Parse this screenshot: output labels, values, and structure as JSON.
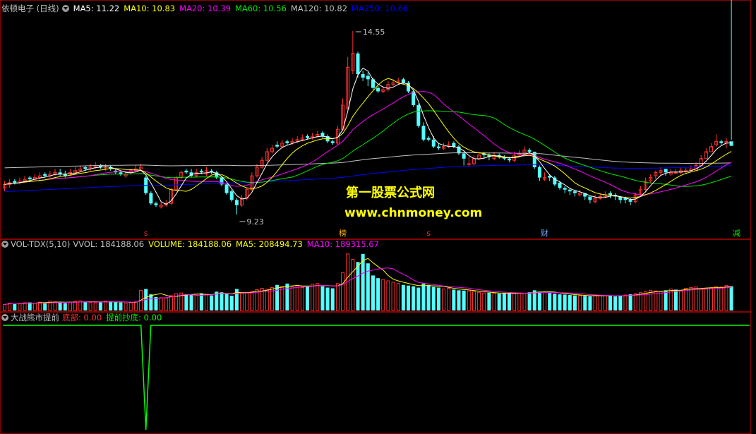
{
  "colors": {
    "up": "#ff3232",
    "down": "#54ffff",
    "bg": "#000000",
    "border": "#8b0000",
    "ma5": "#ffffff",
    "ma10": "#ffff00",
    "ma20": "#ff00ff",
    "ma60": "#00e600",
    "ma120": "#c0c0c0",
    "ma250": "#0000ff",
    "signal": "#00ff00",
    "watermark": "#ffff00"
  },
  "main_legend": {
    "title": "依顿电子 (日线)",
    "ma5": "MA5: 11.22",
    "ma10": "MA10: 10.83",
    "ma20": "MA20: 10.39",
    "ma60": "MA60: 10.56",
    "ma120": "MA120: 10.82",
    "ma250": "MA250: 10.66"
  },
  "annotations": {
    "high": "14.55",
    "low": "9.23"
  },
  "markers": [
    {
      "label": "s",
      "color": "#ff3232",
      "index": 28
    },
    {
      "label": "榜",
      "color": "#ffb400",
      "index": 67
    },
    {
      "label": "s",
      "color": "#ff3232",
      "index": 84
    },
    {
      "label": "财",
      "color": "#6fa8ff",
      "index": 107
    },
    {
      "label": "减",
      "color": "#00e600",
      "index": 145
    }
  ],
  "watermark": {
    "line1": "第一股票公式网",
    "line2": "www.chnmoney.com"
  },
  "vol_legend": {
    "name": "VOL-TDX(5,10)",
    "vvol": "VVOL: 184188.06",
    "volume": "VOLUME: 184188.06",
    "ma5": "MA5: 208494.73",
    "ma10": "MA10: 189315.67"
  },
  "ind_legend": {
    "name": "大战熊市提前",
    "bottom": "底部: 0.00",
    "early": "提前抄底: 0.00"
  },
  "chart_data": [
    {
      "type": "candlestick",
      "title": "依顿电子 (日线)",
      "ylim": [
        8.9,
        15.0
      ],
      "close": [
        10.1,
        10.15,
        10.15,
        10.2,
        10.25,
        10.25,
        10.3,
        10.35,
        10.35,
        10.4,
        10.45,
        10.4,
        10.35,
        10.45,
        10.5,
        10.55,
        10.55,
        10.6,
        10.65,
        10.6,
        10.6,
        10.55,
        10.45,
        10.4,
        10.4,
        10.5,
        10.55,
        10.6,
        9.85,
        9.55,
        9.5,
        9.5,
        9.55,
        9.95,
        10.3,
        10.45,
        10.45,
        10.35,
        10.45,
        10.45,
        10.5,
        10.45,
        10.3,
        10.1,
        9.85,
        9.65,
        9.5,
        9.7,
        9.95,
        10.35,
        10.6,
        10.8,
        11.05,
        11.15,
        11.2,
        11.3,
        11.3,
        11.35,
        11.4,
        11.45,
        11.45,
        11.5,
        11.55,
        11.5,
        11.35,
        11.3,
        11.7,
        12.4,
        13.5,
        13.9,
        13.3,
        13.2,
        13.15,
        12.9,
        12.8,
        12.85,
        13.0,
        13.05,
        13.1,
        13.05,
        12.8,
        12.4,
        11.8,
        11.4,
        11.4,
        11.2,
        11.15,
        11.2,
        11.25,
        11.2,
        11.0,
        10.85,
        10.7,
        10.85,
        10.95,
        10.95,
        10.9,
        10.95,
        10.9,
        10.85,
        10.8,
        10.95,
        11.0,
        11.1,
        11.05,
        10.6,
        10.3,
        10.3,
        10.3,
        10.1,
        10.0,
        9.95,
        9.9,
        9.85,
        9.85,
        9.75,
        9.65,
        9.7,
        9.75,
        9.8,
        9.8,
        9.75,
        9.65,
        9.65,
        9.6,
        9.8,
        9.95,
        10.2,
        10.3,
        10.45,
        10.5,
        10.45,
        10.45,
        10.45,
        10.5,
        10.5,
        10.55,
        10.65,
        10.85,
        11.05,
        11.2,
        11.35,
        11.3,
        11.35,
        11.22
      ],
      "open": [
        10.0,
        10.1,
        10.2,
        10.15,
        10.2,
        10.3,
        10.25,
        10.3,
        10.4,
        10.35,
        10.4,
        10.45,
        10.4,
        10.4,
        10.45,
        10.5,
        10.6,
        10.55,
        10.6,
        10.65,
        10.55,
        10.6,
        10.5,
        10.45,
        10.35,
        10.45,
        10.5,
        10.55,
        10.3,
        9.85,
        9.55,
        9.45,
        9.5,
        9.55,
        9.95,
        10.3,
        10.5,
        10.45,
        10.35,
        10.5,
        10.4,
        10.5,
        10.45,
        10.3,
        10.1,
        9.9,
        9.65,
        9.5,
        9.7,
        9.95,
        10.35,
        10.6,
        10.8,
        11.05,
        11.25,
        11.2,
        11.35,
        11.3,
        11.35,
        11.4,
        11.5,
        11.45,
        11.5,
        11.6,
        11.5,
        11.35,
        11.3,
        11.7,
        12.3,
        13.4,
        13.9,
        13.3,
        13.25,
        13.15,
        12.9,
        12.8,
        12.85,
        13.0,
        13.05,
        13.15,
        13.05,
        12.8,
        12.4,
        11.8,
        11.45,
        11.4,
        11.2,
        11.15,
        11.2,
        11.3,
        11.2,
        11.0,
        10.7,
        10.7,
        10.85,
        11.0,
        10.95,
        10.85,
        10.95,
        10.9,
        10.85,
        10.8,
        10.95,
        11.0,
        11.1,
        11.05,
        10.6,
        10.25,
        10.35,
        10.3,
        10.15,
        10.0,
        9.95,
        9.9,
        9.8,
        9.85,
        9.75,
        9.6,
        9.7,
        9.75,
        9.85,
        9.8,
        9.75,
        9.7,
        9.65,
        9.6,
        9.8,
        9.95,
        10.2,
        10.35,
        10.45,
        10.55,
        10.4,
        10.45,
        10.45,
        10.5,
        10.5,
        10.5,
        10.65,
        10.85,
        11.05,
        11.25,
        11.35,
        11.3,
        11.35
      ],
      "high": [
        10.2,
        10.25,
        10.25,
        10.3,
        10.35,
        10.35,
        10.4,
        10.45,
        10.45,
        10.5,
        10.55,
        10.55,
        10.5,
        10.55,
        10.6,
        10.65,
        10.65,
        10.7,
        10.75,
        10.7,
        10.7,
        10.65,
        10.55,
        10.5,
        10.5,
        10.55,
        10.65,
        10.7,
        10.35,
        9.9,
        9.6,
        9.6,
        9.65,
        10.0,
        10.35,
        10.5,
        10.55,
        10.55,
        10.55,
        10.55,
        10.6,
        10.55,
        10.5,
        10.35,
        10.15,
        9.95,
        9.7,
        9.8,
        10.0,
        10.45,
        10.7,
        10.9,
        11.15,
        11.25,
        11.35,
        11.4,
        11.4,
        11.45,
        11.5,
        11.55,
        11.55,
        11.6,
        11.65,
        11.65,
        11.55,
        11.4,
        11.8,
        12.6,
        13.8,
        14.55,
        13.95,
        13.4,
        13.35,
        13.2,
        12.95,
        12.95,
        13.1,
        13.15,
        13.2,
        13.2,
        13.1,
        12.85,
        12.45,
        11.9,
        11.5,
        11.5,
        11.3,
        11.3,
        11.35,
        11.35,
        11.25,
        11.05,
        10.9,
        10.95,
        11.05,
        11.05,
        11.0,
        11.05,
        11.0,
        10.95,
        10.9,
        11.05,
        11.1,
        11.2,
        11.15,
        11.05,
        10.65,
        10.45,
        10.4,
        10.35,
        10.2,
        10.05,
        10.0,
        9.95,
        9.95,
        9.85,
        9.75,
        9.8,
        9.85,
        9.9,
        9.9,
        9.85,
        9.75,
        9.75,
        9.7,
        9.85,
        10.05,
        10.3,
        10.4,
        10.5,
        10.6,
        10.55,
        10.55,
        10.55,
        10.6,
        10.6,
        10.65,
        10.75,
        10.95,
        11.15,
        11.3,
        11.55,
        11.4,
        11.45,
        11.4
      ],
      "low": [
        9.9,
        10.0,
        10.1,
        10.1,
        10.15,
        10.2,
        10.2,
        10.25,
        10.3,
        10.3,
        10.35,
        10.35,
        10.3,
        10.35,
        10.4,
        10.45,
        10.5,
        10.5,
        10.55,
        10.55,
        10.5,
        10.5,
        10.4,
        10.35,
        10.3,
        10.4,
        10.45,
        10.5,
        9.8,
        9.5,
        9.45,
        9.4,
        9.45,
        9.5,
        9.9,
        10.25,
        10.4,
        10.3,
        10.3,
        10.4,
        10.35,
        10.4,
        10.25,
        10.05,
        9.8,
        9.6,
        9.23,
        9.45,
        9.65,
        9.9,
        10.3,
        10.55,
        10.75,
        11.0,
        11.15,
        11.15,
        11.25,
        11.25,
        11.3,
        11.35,
        11.4,
        11.4,
        11.45,
        11.45,
        11.3,
        11.25,
        11.25,
        11.65,
        12.25,
        13.3,
        13.2,
        13.1,
        12.95,
        12.85,
        12.75,
        12.75,
        12.8,
        12.95,
        13.0,
        13.0,
        12.75,
        12.35,
        11.75,
        11.35,
        11.35,
        11.15,
        11.1,
        11.1,
        11.15,
        11.15,
        10.95,
        10.65,
        10.6,
        10.65,
        10.8,
        10.85,
        10.8,
        10.8,
        10.85,
        10.8,
        10.75,
        10.75,
        10.9,
        11.0,
        11.0,
        10.55,
        10.2,
        10.2,
        10.2,
        10.05,
        9.95,
        9.85,
        9.8,
        9.75,
        9.75,
        9.65,
        9.55,
        9.55,
        9.65,
        9.7,
        9.7,
        9.65,
        9.55,
        9.55,
        9.5,
        9.55,
        9.75,
        9.9,
        10.15,
        10.25,
        10.35,
        10.35,
        10.35,
        10.4,
        10.4,
        10.4,
        10.45,
        10.55,
        10.8,
        11.0,
        11.15,
        11.2,
        11.25,
        11.15
      ],
      "ma5_last": 11.22,
      "ma10_last": 10.83,
      "ma20_last": 10.39,
      "ma60_last": 10.56,
      "ma120_last": 10.82,
      "ma250_last": 10.66,
      "annotations": [
        {
          "text": "14.55",
          "value": 14.55
        },
        {
          "text": "9.23",
          "value": 9.23
        }
      ]
    },
    {
      "type": "bar",
      "title": "VOL-TDX(5,10)",
      "series_names": [
        "VOLUME",
        "MA5",
        "MA10"
      ],
      "values": [
        45,
        55,
        50,
        52,
        58,
        60,
        55,
        62,
        58,
        70,
        65,
        60,
        55,
        62,
        68,
        72,
        66,
        60,
        58,
        65,
        70,
        68,
        62,
        60,
        55,
        58,
        65,
        150,
        160,
        120,
        100,
        95,
        92,
        110,
        125,
        130,
        118,
        115,
        120,
        128,
        118,
        112,
        140,
        135,
        125,
        110,
        160,
        130,
        135,
        142,
        155,
        165,
        158,
        170,
        190,
        180,
        200,
        175,
        185,
        170,
        180,
        195,
        200,
        180,
        170,
        165,
        200,
        280,
        420,
        380,
        360,
        420,
        350,
        260,
        240,
        230,
        220,
        210,
        200,
        190,
        185,
        180,
        170,
        200,
        190,
        175,
        170,
        160,
        165,
        155,
        150,
        148,
        145,
        140,
        135,
        130,
        132,
        128,
        125,
        130,
        128,
        125,
        130,
        128,
        135,
        150,
        140,
        138,
        130,
        125,
        120,
        118,
        115,
        112,
        110,
        108,
        105,
        115,
        112,
        110,
        108,
        105,
        110,
        115,
        120,
        125,
        135,
        140,
        150,
        145,
        140,
        150,
        160,
        155,
        148,
        165,
        170,
        175,
        160,
        165,
        170,
        178,
        175,
        185,
        180
      ],
      "up": [
        true,
        true,
        false,
        true,
        true,
        false,
        true,
        true,
        false,
        true,
        true,
        false,
        false,
        true,
        true,
        true,
        false,
        true,
        true,
        false,
        true,
        false,
        false,
        false,
        true,
        true,
        true,
        true,
        false,
        false,
        false,
        true,
        true,
        true,
        true,
        true,
        false,
        false,
        true,
        false,
        true,
        false,
        false,
        false,
        false,
        false,
        false,
        true,
        true,
        true,
        true,
        true,
        true,
        true,
        false,
        true,
        false,
        true,
        true,
        true,
        false,
        true,
        true,
        false,
        false,
        false,
        true,
        true,
        true,
        true,
        false,
        false,
        false,
        false,
        false,
        true,
        true,
        true,
        true,
        false,
        false,
        false,
        false,
        false,
        false,
        false,
        false,
        true,
        true,
        false,
        false,
        false,
        true,
        true,
        true,
        true,
        false,
        true,
        false,
        false,
        false,
        true,
        true,
        true,
        false,
        false,
        false,
        true,
        false,
        false,
        false,
        false,
        false,
        false,
        true,
        false,
        false,
        true,
        true,
        true,
        false,
        false,
        false,
        true,
        false,
        true,
        true,
        true,
        true,
        true,
        true,
        false,
        true,
        false,
        true,
        true,
        true,
        true,
        true,
        true,
        true,
        true,
        true,
        true,
        false,
        true
      ]
    },
    {
      "type": "line",
      "title": "大战熊市提前",
      "series_names": [
        "底部",
        "提前抄底"
      ],
      "signal_index": 28,
      "baseline": 0,
      "signal_value": -1
    }
  ]
}
